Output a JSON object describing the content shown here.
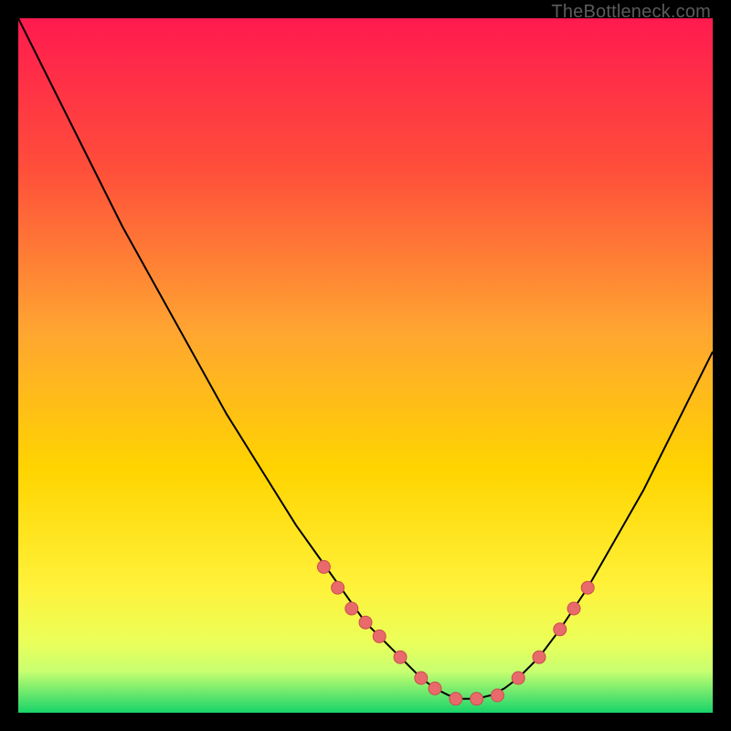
{
  "watermark": "TheBottleneck.com",
  "colors": {
    "frame": "#000000",
    "gradient_top": "#ff1a4f",
    "gradient_mid1": "#ff7a2a",
    "gradient_mid2": "#ffd400",
    "gradient_mid3": "#f7ff3a",
    "gradient_bottom": "#18d46a",
    "curve": "#000000",
    "marker_fill": "#e86a6a",
    "marker_stroke": "#c94f4f"
  },
  "chart_data": {
    "type": "line",
    "title": "",
    "xlabel": "",
    "ylabel": "",
    "xlim": [
      0,
      100
    ],
    "ylim": [
      0,
      100
    ],
    "curve": {
      "x": [
        0,
        5,
        10,
        15,
        20,
        25,
        30,
        35,
        40,
        45,
        50,
        52,
        55,
        58,
        60,
        62,
        64,
        66,
        68,
        70,
        72,
        75,
        78,
        82,
        86,
        90,
        95,
        100
      ],
      "y": [
        100,
        90,
        80,
        70,
        61,
        52,
        43,
        35,
        27,
        20,
        13,
        11,
        8,
        5,
        3.5,
        2.5,
        2,
        2,
        2.5,
        3.5,
        5,
        8,
        12,
        18,
        25,
        32,
        42,
        52
      ]
    },
    "markers": {
      "x": [
        44,
        46,
        48,
        50,
        52,
        55,
        58,
        60,
        63,
        66,
        69,
        72,
        75,
        78,
        80,
        82
      ],
      "y": [
        21,
        18,
        15,
        13,
        11,
        8,
        5,
        3.5,
        2,
        2,
        2.5,
        5,
        8,
        12,
        15,
        18
      ]
    },
    "green_band": {
      "y_top": 7,
      "y_bottom": 0
    }
  }
}
